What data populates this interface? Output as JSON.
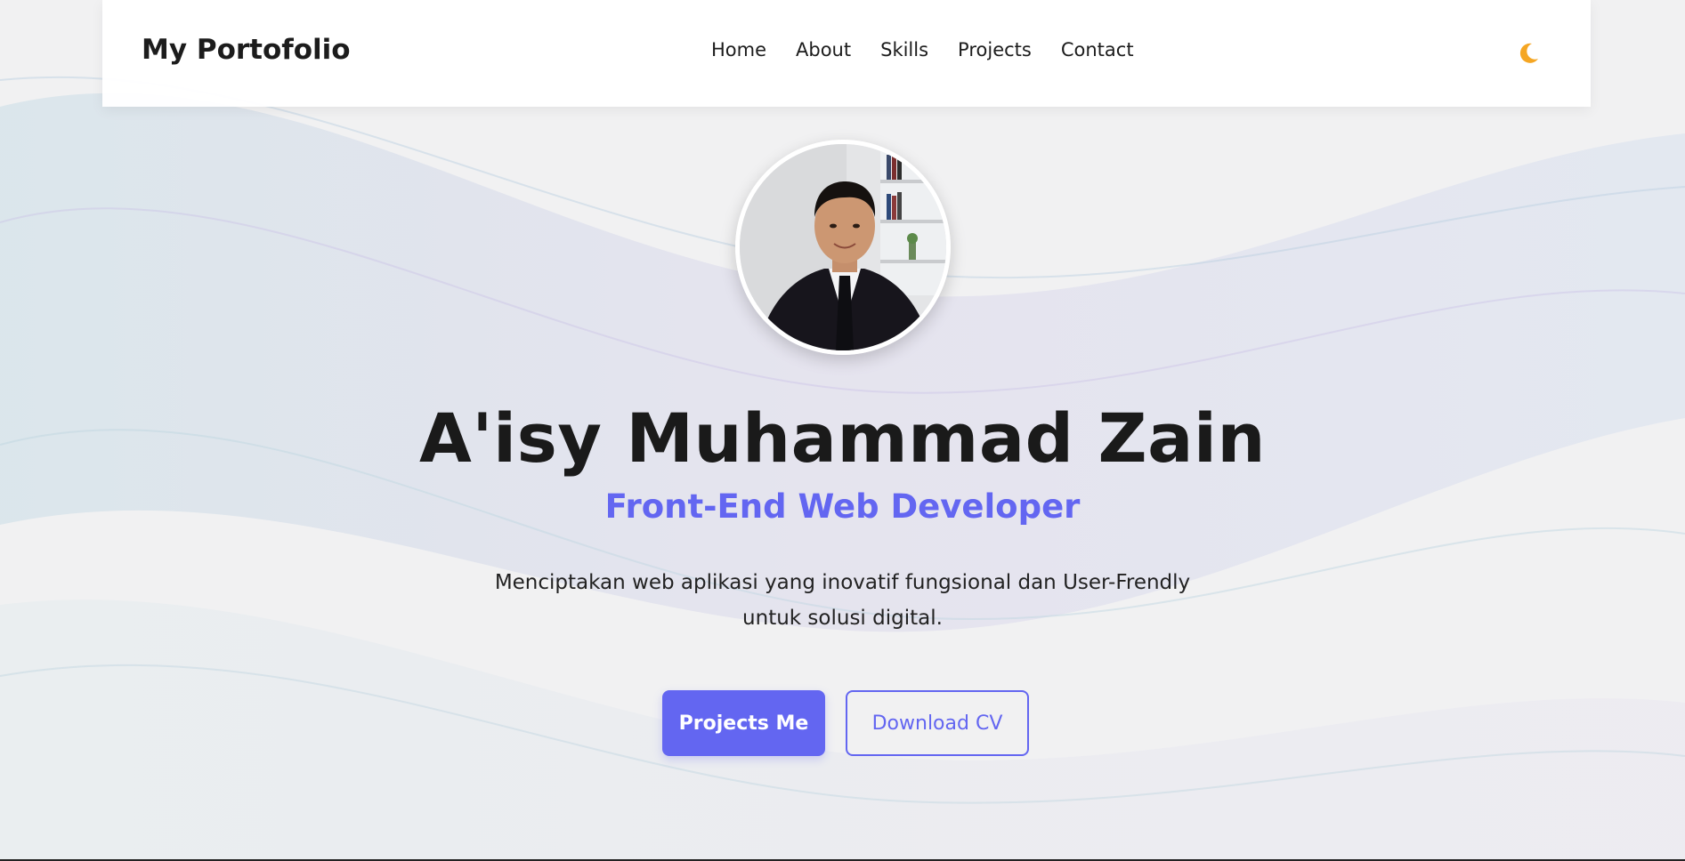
{
  "navbar": {
    "brand": "My Portofolio",
    "links": [
      {
        "label": "Home"
      },
      {
        "label": "About"
      },
      {
        "label": "Skills"
      },
      {
        "label": "Projects"
      },
      {
        "label": "Contact"
      }
    ],
    "theme_toggle_icon": "moon-icon"
  },
  "hero": {
    "name": "A'isy Muhammad Zain",
    "role": "Front-End Web Developer",
    "description": "Menciptakan web aplikasi yang inovatif fungsional dan User-Frendly untuk solusi digital.",
    "primary_button": "Projects Me",
    "secondary_button": "Download CV"
  },
  "colors": {
    "accent": "#6366f1",
    "text": "#1a1a1a",
    "background": "#f1f1f2",
    "moon": "#f5a623"
  }
}
